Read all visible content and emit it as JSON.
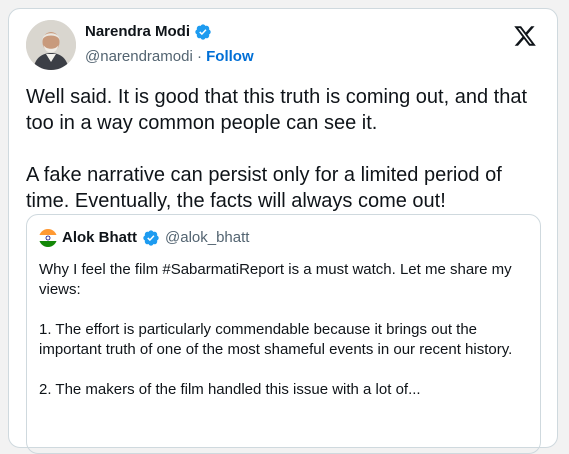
{
  "tweet": {
    "author": {
      "name": "Narendra Modi",
      "handle": "@narendramodi",
      "separator": "·",
      "follow_label": "Follow"
    },
    "paragraphs": [
      "Well said. It is good that this truth is coming out, and that too in a way common people can see it.",
      "A fake narrative can persist only for a limited period of time. Eventually, the facts will always come out!"
    ]
  },
  "quoted_tweet": {
    "author": {
      "name": "Alok Bhatt",
      "handle": "@alok_bhatt"
    },
    "paragraphs": [
      "Why I feel the film #SabarmatiReport is a must watch. Let me share my views:",
      "1. The effort is particularly commendable because it brings out the important truth of one of the most shameful events in our recent history.",
      "2. The makers of the film handled this issue with a lot of..."
    ]
  },
  "icons": {
    "verified": "verified-badge-icon",
    "brand": "x-logo-icon"
  },
  "colors": {
    "verified": "#1d9bf0",
    "link": "#006fd6",
    "secondary_text": "#536471",
    "border": "#cfd9de"
  }
}
